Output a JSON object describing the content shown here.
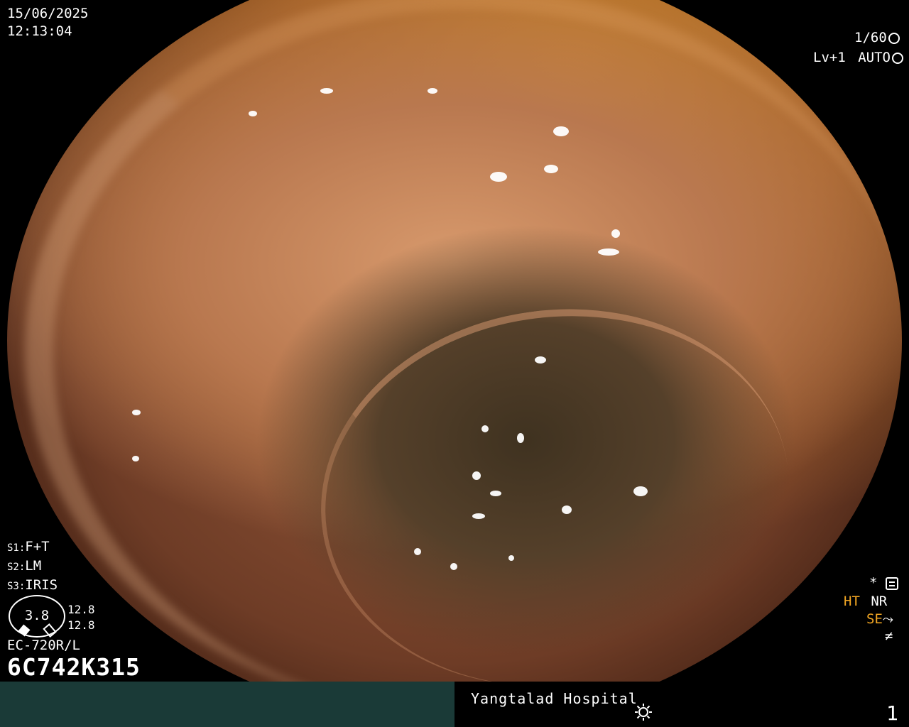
{
  "datetime": {
    "date": "15/06/2025",
    "time": "12:13:04"
  },
  "top_right": {
    "shutter": "1/60",
    "shutter_icon": "aperture-icon",
    "level": "Lv+1",
    "mode": "AUTO",
    "mode_icon": "iris-icon"
  },
  "settings": [
    {
      "key": "S1:",
      "value": "F+T"
    },
    {
      "key": "S2:",
      "value": "LM"
    },
    {
      "key": "S3:",
      "value": "IRIS"
    }
  ],
  "zoom": {
    "value": "3.8",
    "upper": "12.8",
    "lower": "12.8"
  },
  "scope": {
    "model": "EC-720R/L",
    "serial": "6C742K315"
  },
  "right_status": {
    "star": "*",
    "star_icon": "settings-panel-icon",
    "ht": "HT",
    "nr": "NR",
    "se": "SE",
    "se_icon": "enhance-curve-icon",
    "last_icon": "not-equal-icon"
  },
  "bottom_bar": {
    "hospital": "Yangtalad Hospital",
    "light_icon": "sun-icon",
    "page": "1"
  },
  "colors": {
    "bar": "#1a3a37",
    "amber": "#f2a623"
  }
}
